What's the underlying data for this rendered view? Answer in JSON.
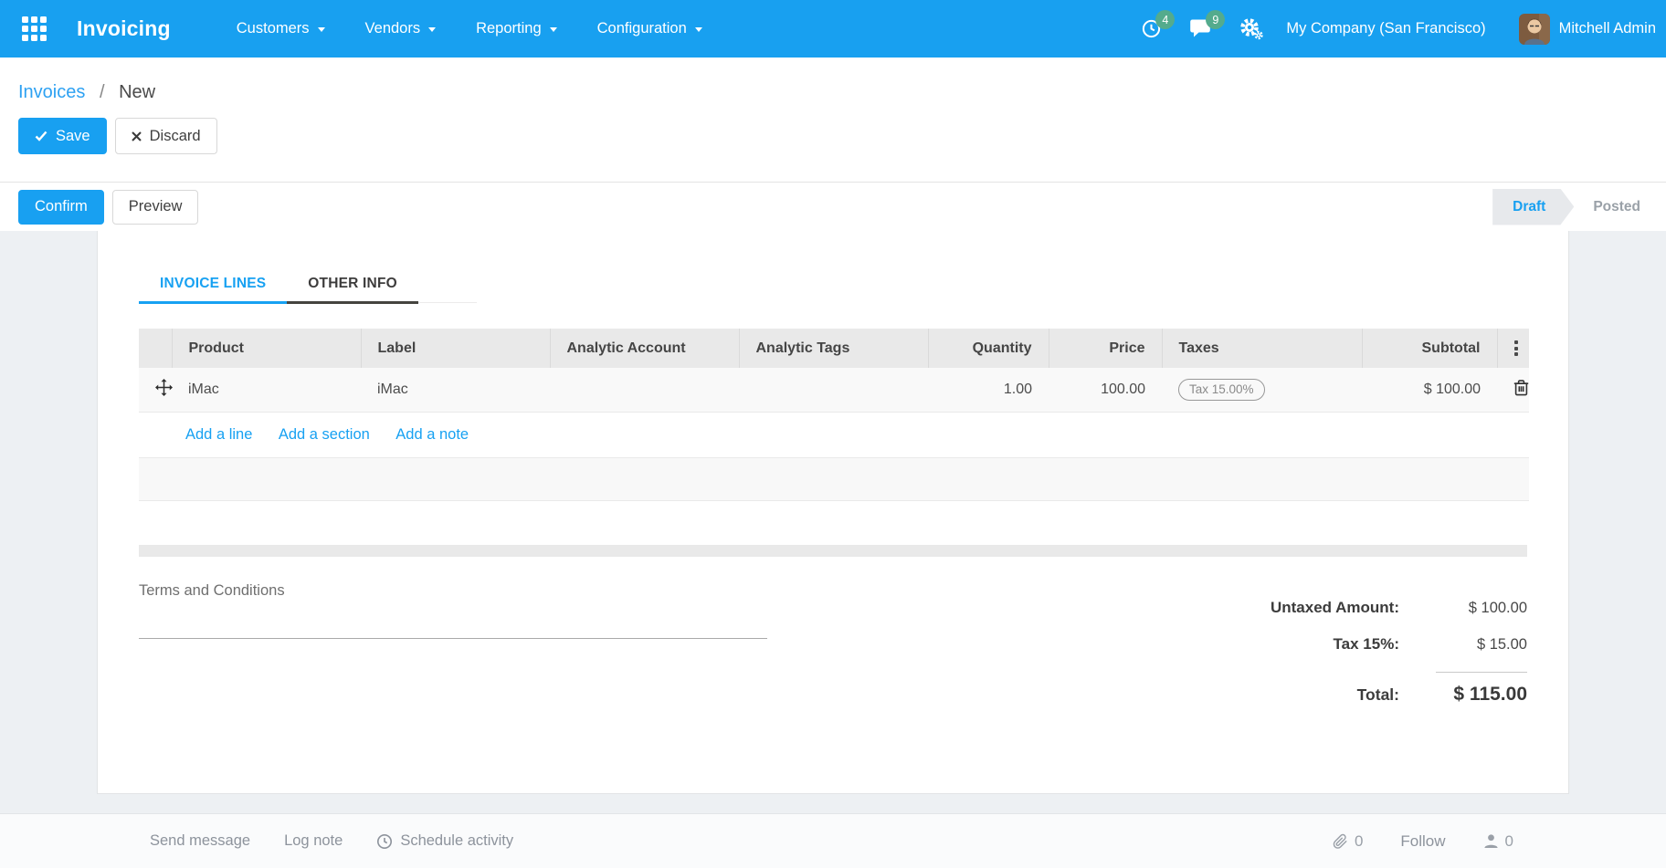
{
  "colors": {
    "primary": "#18a0f1",
    "badge_green": "#54ab8d",
    "navbar": "#18a0f0"
  },
  "navbar": {
    "brand": "Invoicing",
    "menus": [
      "Customers",
      "Vendors",
      "Reporting",
      "Configuration"
    ],
    "activity_count": "4",
    "message_count": "9",
    "company": "My Company (San Francisco)",
    "user": "Mitchell Admin"
  },
  "breadcrumb": {
    "parent": "Invoices",
    "separator": "/",
    "current": "New"
  },
  "actions": {
    "save": "Save",
    "discard": "Discard",
    "confirm": "Confirm",
    "preview": "Preview"
  },
  "statusbar": {
    "draft": "Draft",
    "posted": "Posted"
  },
  "tabs": {
    "invoice_lines": "INVOICE LINES",
    "other_info": "OTHER INFO"
  },
  "invoice_lines": {
    "columns": [
      "Product",
      "Label",
      "Analytic Account",
      "Analytic Tags",
      "Quantity",
      "Price",
      "Taxes",
      "Subtotal"
    ],
    "rows": [
      {
        "product": "iMac",
        "label": "iMac",
        "analytic_account": "",
        "analytic_tags": "",
        "quantity": "1.00",
        "price": "100.00",
        "taxes": "Tax 15.00%",
        "subtotal": "$ 100.00"
      }
    ],
    "add_links": [
      "Add a line",
      "Add a section",
      "Add a note"
    ]
  },
  "terms": {
    "label": "Terms and Conditions"
  },
  "totals": {
    "rows": [
      {
        "label": "Untaxed Amount:",
        "value": "$ 100.00"
      },
      {
        "label": "Tax 15%:",
        "value": "$ 15.00"
      }
    ],
    "total_label": "Total:",
    "total_value": "$ 115.00"
  },
  "chatter": {
    "send_message": "Send message",
    "log_note": "Log note",
    "schedule_activity": "Schedule activity",
    "attachments_count": "0",
    "follow": "Follow",
    "followers_count": "0"
  }
}
